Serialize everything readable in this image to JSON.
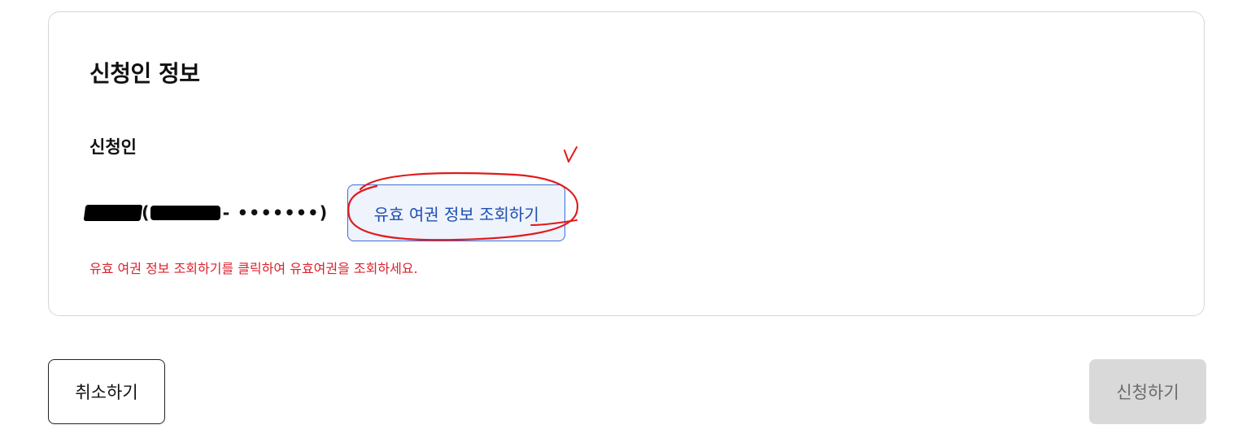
{
  "section": {
    "title": "신청인 정보",
    "field_label": "신청인",
    "applicant_id_suffix": "- •••••••)",
    "open_paren": "(",
    "lookup_button_label": "유효 여권 정보 조회하기",
    "hint": "유효 여권 정보 조회하기를 클릭하여 유효여권을 조회하세요."
  },
  "annotation": {
    "mark": "V",
    "color": "#e01b1b"
  },
  "footer": {
    "cancel_label": "취소하기",
    "apply_label": "신청하기"
  },
  "colors": {
    "hint": "#d9232e",
    "lookup_border": "#3a6fd8",
    "lookup_bg": "#eef3fc",
    "apply_disabled_bg": "#d9d9d9"
  }
}
